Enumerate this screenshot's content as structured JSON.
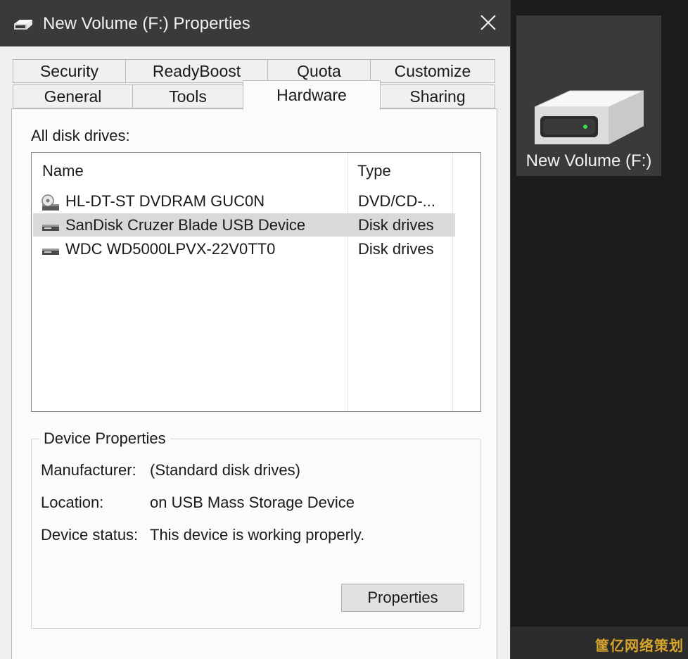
{
  "window": {
    "title": "New Volume (F:) Properties",
    "close_symbol": "✕"
  },
  "tabs": {
    "row_back": [
      "Security",
      "ReadyBoost",
      "Quota",
      "Customize"
    ],
    "row_front": [
      "General",
      "Tools",
      "Hardware",
      "Sharing"
    ],
    "active": "Hardware"
  },
  "hardware": {
    "list_label": "All disk drives:",
    "columns": {
      "name": "Name",
      "type": "Type"
    },
    "drives": [
      {
        "name": "HL-DT-ST DVDRAM GUC0N",
        "type": "DVD/CD-...",
        "icon": "optical-drive-icon",
        "selected": false
      },
      {
        "name": "SanDisk Cruzer Blade USB Device",
        "type": "Disk drives",
        "icon": "disk-drive-icon",
        "selected": true
      },
      {
        "name": "WDC WD5000LPVX-22V0TT0",
        "type": "Disk drives",
        "icon": "disk-drive-icon",
        "selected": false
      }
    ]
  },
  "device_properties": {
    "title": "Device Properties",
    "manufacturer_label": "Manufacturer:",
    "manufacturer_value": "(Standard disk drives)",
    "location_label": "Location:",
    "location_value": "on USB Mass Storage Device",
    "status_label": "Device status:",
    "status_value": "This device is working properly.",
    "properties_button": "Properties"
  },
  "desktop": {
    "icon_label": "New Volume (F:)",
    "watermark": "筐亿网络策划"
  },
  "colors": {
    "titlebar": "#3a3a3a",
    "panel": "#fbfbfb",
    "selected_row": "#d9d9d9",
    "drive_led": "#3adf4a"
  }
}
